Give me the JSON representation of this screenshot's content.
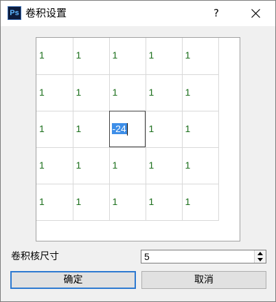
{
  "window": {
    "title": "卷积设置",
    "app_icon_text": "Ps",
    "help_label": "?",
    "close_label": "✕"
  },
  "kernel": {
    "rows": [
      [
        "1",
        "1",
        "1",
        "1",
        "1"
      ],
      [
        "1",
        "1",
        "1",
        "1",
        "1"
      ],
      [
        "1",
        "1",
        "-24",
        "1",
        "1"
      ],
      [
        "1",
        "1",
        "1",
        "1",
        "1"
      ],
      [
        "1",
        "1",
        "1",
        "1",
        "1"
      ]
    ],
    "editing_cell": [
      2,
      2
    ]
  },
  "kernel_size": {
    "label": "卷积核尺寸",
    "value": "5"
  },
  "buttons": {
    "ok": "确定",
    "cancel": "取消"
  },
  "colors": {
    "cell_text": "#1a6e1a",
    "selection": "#3d8ee8",
    "default_button_border": "#2b78d0"
  }
}
